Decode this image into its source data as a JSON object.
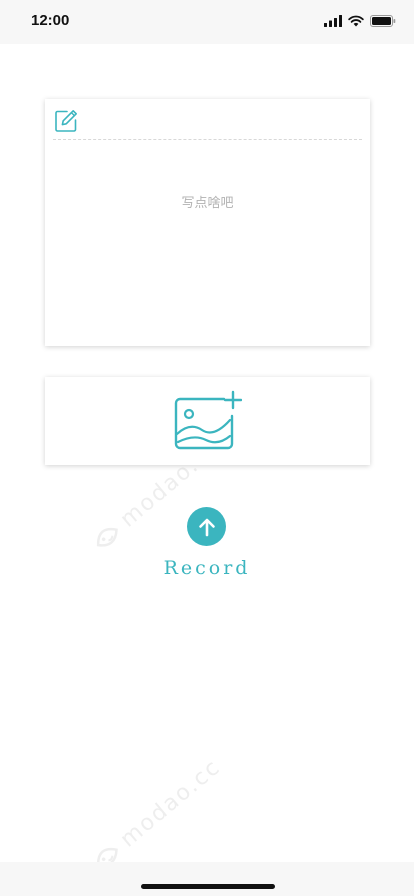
{
  "status_bar": {
    "time": "12:00"
  },
  "text_card": {
    "placeholder": "写点啥吧"
  },
  "image_card": {
    "icon": "add-image-icon"
  },
  "record": {
    "label": "Record",
    "icon": "arrow-up-icon"
  },
  "watermark": {
    "text": "modao.cc"
  },
  "colors": {
    "accent": "#3bb5bf",
    "placeholder": "#b2b2b2",
    "divider": "#d8d8d8"
  }
}
